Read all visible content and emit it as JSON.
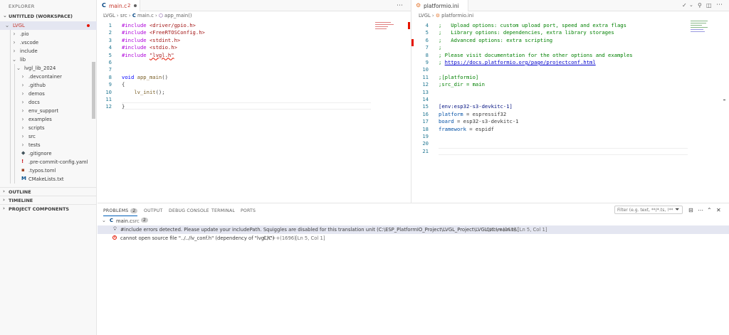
{
  "sidebar": {
    "title": "EXPLORER",
    "workspace": "UNTITLED (WORKSPACE)",
    "root": "LVGL",
    "items": [
      {
        "label": ".pio",
        "kind": "folder"
      },
      {
        "label": ".vscode",
        "kind": "folder"
      },
      {
        "label": "include",
        "kind": "folder"
      },
      {
        "label": "lib",
        "kind": "folder-open"
      },
      {
        "label": "lvgl_lib_2024",
        "kind": "folder-open"
      },
      {
        "label": ".devcontainer",
        "kind": "folder"
      },
      {
        "label": ".github",
        "kind": "folder"
      },
      {
        "label": "demos",
        "kind": "folder"
      },
      {
        "label": "docs",
        "kind": "folder"
      },
      {
        "label": "env_support",
        "kind": "folder"
      },
      {
        "label": "examples",
        "kind": "folder"
      },
      {
        "label": "scripts",
        "kind": "folder"
      },
      {
        "label": "src",
        "kind": "folder"
      },
      {
        "label": "tests",
        "kind": "folder"
      },
      {
        "label": ".gitignore",
        "kind": "file"
      },
      {
        "label": ".pre-commit-config.yaml",
        "kind": "file"
      },
      {
        "label": ".typos.toml",
        "kind": "file"
      },
      {
        "label": "CMakeLists.txt",
        "kind": "file"
      }
    ],
    "sections": {
      "outline": "OUTLINE",
      "timeline": "TIMELINE",
      "components": "PROJECT COMPONENTS"
    }
  },
  "editor_left": {
    "tab_label": "main.c",
    "tab_icon": "C",
    "tab_problems": "2",
    "breadcrumb": [
      "LVGL",
      "src",
      "main.c",
      "app_main()"
    ],
    "lines": [
      {
        "n": "1",
        "parts": [
          [
            "#include ",
            "pp"
          ],
          [
            "<driver/gpio.h>",
            "str"
          ]
        ]
      },
      {
        "n": "2",
        "parts": [
          [
            "#include ",
            "pp"
          ],
          [
            "<FreeRTOSConfig.h>",
            "str"
          ]
        ]
      },
      {
        "n": "3",
        "parts": [
          [
            "#include ",
            "pp"
          ],
          [
            "<stdint.h>",
            "str"
          ]
        ]
      },
      {
        "n": "4",
        "parts": [
          [
            "#include ",
            "pp"
          ],
          [
            "<stdio.h>",
            "str"
          ]
        ]
      },
      {
        "n": "5",
        "parts": [
          [
            "#include ",
            "pp"
          ],
          [
            "\"lvgl.h\"",
            "str squig"
          ]
        ]
      },
      {
        "n": "6",
        "parts": []
      },
      {
        "n": "7",
        "parts": []
      },
      {
        "n": "8",
        "parts": [
          [
            "void ",
            "kw"
          ],
          [
            "app_main",
            "fn"
          ],
          [
            "()",
            ""
          ]
        ]
      },
      {
        "n": "9",
        "parts": [
          [
            "{",
            ""
          ]
        ]
      },
      {
        "n": "10",
        "parts": [
          [
            "    ",
            ""
          ],
          [
            "lv_init",
            "fn"
          ],
          [
            "();",
            ""
          ]
        ]
      },
      {
        "n": "11",
        "parts": []
      },
      {
        "n": "12",
        "parts": [
          [
            "}",
            ""
          ]
        ]
      }
    ]
  },
  "editor_right": {
    "tab_label": "platformio.ini",
    "breadcrumb": [
      "LVGL",
      "platformio.ini"
    ],
    "lines": [
      {
        "n": "4",
        "parts": [
          [
            ";   Upload options: custom upload port, speed and extra flags",
            "cm"
          ]
        ]
      },
      {
        "n": "5",
        "parts": [
          [
            ";   Library options: dependencies, extra library storages",
            "cm"
          ]
        ]
      },
      {
        "n": "6",
        "parts": [
          [
            ";   Advanced options: extra scripting",
            "cm"
          ]
        ]
      },
      {
        "n": "7",
        "parts": [
          [
            ";",
            "cm"
          ]
        ]
      },
      {
        "n": "8",
        "parts": [
          [
            "; Please visit documentation for the other options and examples",
            "cm"
          ]
        ]
      },
      {
        "n": "9",
        "parts": [
          [
            "; ",
            "cm"
          ],
          [
            "https://docs.platformio.org/page/projectconf.html",
            "cm link"
          ]
        ]
      },
      {
        "n": "10",
        "parts": []
      },
      {
        "n": "11",
        "parts": [
          [
            ";[platformio]",
            "cm"
          ]
        ]
      },
      {
        "n": "12",
        "parts": [
          [
            ";src_dir = main",
            "cm"
          ]
        ]
      },
      {
        "n": "13",
        "parts": []
      },
      {
        "n": "14",
        "parts": []
      },
      {
        "n": "15",
        "parts": [
          [
            "[env:esp32-s3-devkitc-1]",
            "var"
          ]
        ]
      },
      {
        "n": "16",
        "parts": [
          [
            "platform",
            "key"
          ],
          [
            " = espressif32",
            ""
          ]
        ]
      },
      {
        "n": "17",
        "parts": [
          [
            "board",
            "key"
          ],
          [
            " = esp32-s3-devkitc-1",
            ""
          ]
        ]
      },
      {
        "n": "18",
        "parts": [
          [
            "framework",
            "key"
          ],
          [
            " = espidf",
            ""
          ]
        ]
      },
      {
        "n": "19",
        "parts": []
      },
      {
        "n": "20",
        "parts": []
      },
      {
        "n": "21",
        "parts": []
      }
    ]
  },
  "panel": {
    "tabs": [
      "PROBLEMS",
      "OUTPUT",
      "DEBUG CONSOLE",
      "TERMINAL",
      "PORTS"
    ],
    "problems_count": "2",
    "filter_placeholder": "Filter (e.g. text, **/*.ts, !**/...",
    "file": {
      "name": "main.c",
      "dir": "src",
      "count": "2"
    },
    "problems": [
      {
        "icon": "lightbulb-icon",
        "message": "#include errors detected. Please update your includePath. Squiggles are disabled for this translation unit (C:\\ESP_PlatformIO_Project\\LVGL_Project\\LVGL\\src\\main.c).",
        "source": "C/C++(1696)",
        "location": "[Ln 5, Col 1]"
      },
      {
        "icon": "error-icon",
        "message": "cannot open source file \"../../lv_conf.h\" (dependency of \"lvgl.h\")",
        "source": "C/C++(1696)",
        "location": "[Ln 5, Col 1]"
      }
    ]
  },
  "colors": {
    "accent": "#005fb8",
    "error": "#e51400",
    "modified": "#c5372c"
  }
}
